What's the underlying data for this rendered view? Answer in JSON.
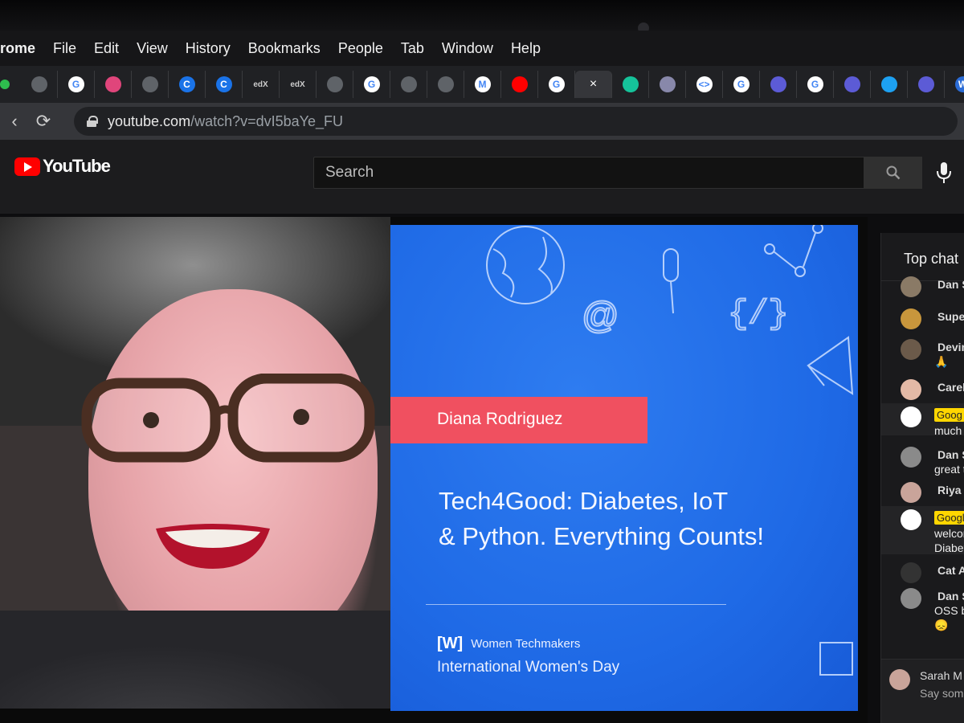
{
  "menubar": {
    "app": "rome",
    "items": [
      "File",
      "Edit",
      "View",
      "History",
      "Bookmarks",
      "People",
      "Tab",
      "Window",
      "Help"
    ]
  },
  "tabs": [
    {
      "icon": "globe-icon",
      "label": "",
      "color": "#5f6368"
    },
    {
      "icon": "google-icon",
      "label": "G",
      "color": "#ffffff"
    },
    {
      "icon": "image-favicon-icon",
      "label": "",
      "color": "#e0457b"
    },
    {
      "icon": "globe-icon",
      "label": "",
      "color": "#5f6368"
    },
    {
      "icon": "coursera-icon",
      "label": "C",
      "color": "#1a73e8"
    },
    {
      "icon": "coursera-icon",
      "label": "C",
      "color": "#1a73e8"
    },
    {
      "icon": "edx-icon",
      "label": "edX",
      "color": "#2b2b2b"
    },
    {
      "icon": "edx-icon",
      "label": "edX",
      "color": "#2b2b2b"
    },
    {
      "icon": "globe-icon",
      "label": "",
      "color": "#5f6368"
    },
    {
      "icon": "google-icon",
      "label": "G",
      "color": "#ffffff"
    },
    {
      "icon": "globe-icon",
      "label": "",
      "color": "#5f6368"
    },
    {
      "icon": "globe-icon",
      "label": "",
      "color": "#5f6368"
    },
    {
      "icon": "gmail-icon",
      "label": "M",
      "color": "#ffffff"
    },
    {
      "icon": "youtube-icon",
      "label": "",
      "color": "#ff0000"
    },
    {
      "icon": "google-icon",
      "label": "G",
      "color": "#ffffff"
    },
    {
      "icon": "close-icon",
      "label": "×",
      "active": true
    },
    {
      "icon": "grammarly-icon",
      "label": "",
      "color": "#15c39a"
    },
    {
      "icon": "photo-icon",
      "label": "",
      "color": "#8888aa"
    },
    {
      "icon": "code-icon",
      "label": "<>",
      "color": "#ffffff"
    },
    {
      "icon": "google-icon",
      "label": "G",
      "color": "#ffffff"
    },
    {
      "icon": "list-icon",
      "label": "",
      "color": "#5c5bd6"
    },
    {
      "icon": "google-icon",
      "label": "G",
      "color": "#ffffff"
    },
    {
      "icon": "list-icon",
      "label": "",
      "color": "#5c5bd6"
    },
    {
      "icon": "twitter-icon",
      "label": "",
      "color": "#1da1f2"
    },
    {
      "icon": "list-icon",
      "label": "",
      "color": "#5c5bd6"
    },
    {
      "icon": "wtm-icon",
      "label": "W",
      "color": "#2b6cd6"
    }
  ],
  "address": {
    "host": "youtube.com",
    "path": "/watch?v=dvI5baYe_FU"
  },
  "youtube": {
    "logo_text": "YouTube",
    "search_placeholder": "Search"
  },
  "slide": {
    "speaker": "Diana Rodriguez",
    "title_line1": "Tech4Good: Diabetes, IoT",
    "title_line2": "& Python. Everything Counts!",
    "org_logo": "[W]",
    "org_name": "Women Techmakers",
    "event": "International Women's Day",
    "accent": "#f05060",
    "background": "#1f6ae6"
  },
  "chat": {
    "header": "Top chat",
    "messages": [
      {
        "name": "Dan S",
        "text": "",
        "avatar": "#8a7a66"
      },
      {
        "name": "Supe",
        "text": "",
        "avatar": "#c8963c"
      },
      {
        "name": "Devin",
        "text": "🙏",
        "avatar": "#6b5a4a"
      },
      {
        "name": "Carel",
        "text": "",
        "avatar": "#e3b9a6"
      },
      {
        "name": "",
        "badge": "Goog",
        "text": "much",
        "avatar": "#ffffff",
        "highlight": true
      },
      {
        "name": "Dan St",
        "text": "great t",
        "avatar": "#8a8a8a"
      },
      {
        "name": "Riya D",
        "text": "",
        "avatar": "#c9a49a"
      },
      {
        "name": "",
        "badge": "Googl",
        "text": "welcom",
        "text2": "Diabete",
        "avatar": "#ffffff",
        "highlight": true
      },
      {
        "name": "Cat Alln",
        "text": "",
        "avatar": "#333333"
      },
      {
        "name": "Dan Sto",
        "text": "OSS bo",
        "text2": "😞",
        "avatar": "#8a8a8a"
      },
      {
        "name": "Sarah M",
        "text": "Say some",
        "avatar": "#c9a49a"
      }
    ]
  }
}
